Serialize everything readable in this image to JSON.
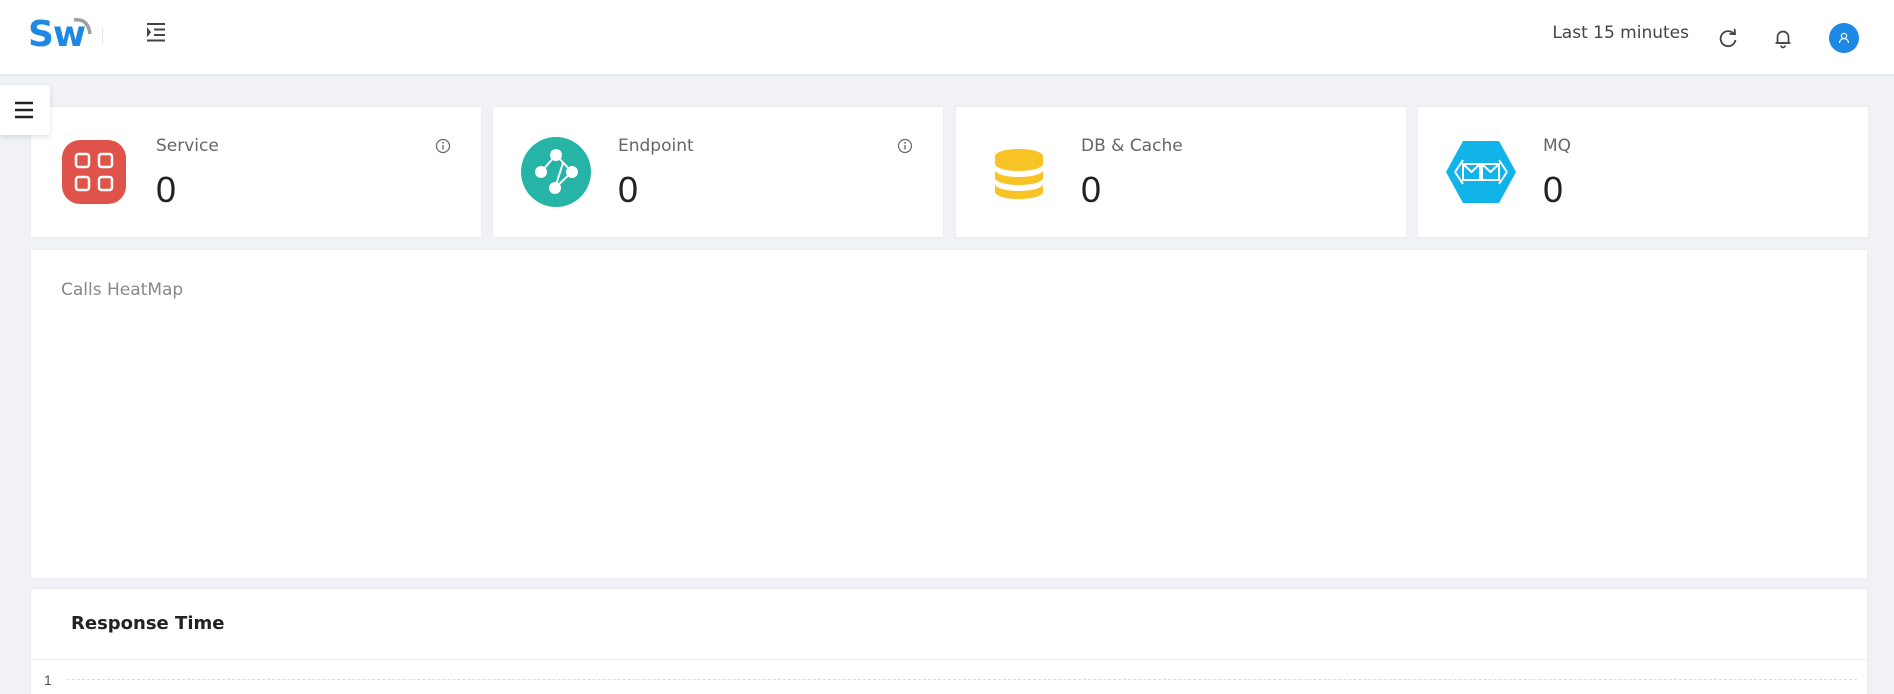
{
  "header": {
    "logo_text": "Sw",
    "time_range": "Last 15 minutes"
  },
  "icons": {
    "menu_fold": "menu-fold-icon",
    "refresh": "refresh-icon",
    "bell": "bell-icon",
    "user": "user-icon",
    "sidebar_toggle": "hamburger-icon",
    "info": "info-circle-icon"
  },
  "colors": {
    "brand": "#1e88e5",
    "service": "#e0534a",
    "endpoint": "#26b4a6",
    "db": "#f7c325",
    "mq": "#11b4e8"
  },
  "cards": [
    {
      "label": "Service",
      "count": "0",
      "icon": "service-grid-icon"
    },
    {
      "label": "Endpoint",
      "count": "0",
      "icon": "endpoint-graph-icon"
    },
    {
      "label": "DB & Cache",
      "count": "0",
      "icon": "database-icon"
    },
    {
      "label": "MQ",
      "count": "0",
      "icon": "message-queue-icon"
    }
  ],
  "heatmap": {
    "title": "Calls HeatMap"
  },
  "response_time": {
    "title": "Response Time",
    "y_tick": "1"
  }
}
